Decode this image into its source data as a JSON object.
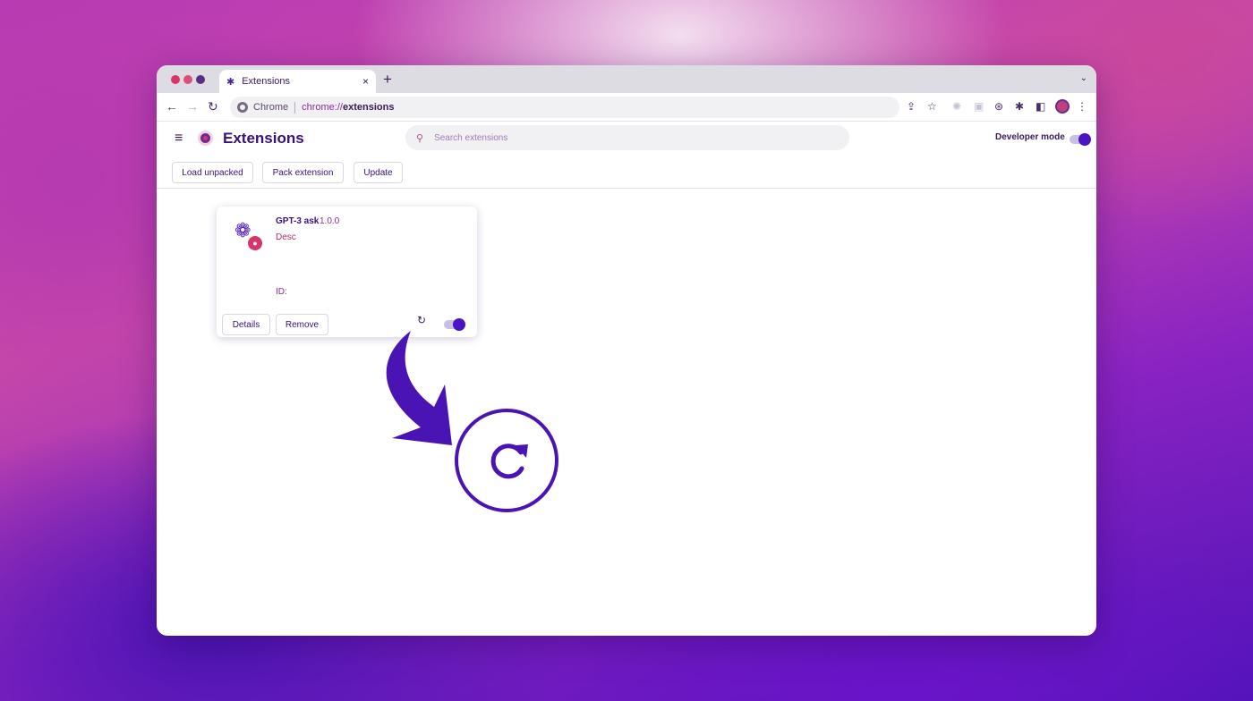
{
  "browser": {
    "tab": {
      "icon": "puzzle-icon",
      "title": "Extensions",
      "close": "×"
    },
    "new_tab": "+",
    "tab_dropdown": "⌄",
    "omnibox": {
      "site_label": "Chrome",
      "url_scheme": "chrome://",
      "url_host": "extensions"
    }
  },
  "page": {
    "title": "Extensions",
    "search_placeholder": "Search extensions",
    "developer_mode_label": "Developer mode",
    "developer_mode_on": true
  },
  "actions": {
    "load_unpacked": "Load unpacked",
    "pack_extension": "Pack extension",
    "update": "Update"
  },
  "extension_card": {
    "name": "GPT-3 ask",
    "version": "1.0.0",
    "description": "Desc",
    "id_label": "ID:",
    "details_label": "Details",
    "remove_label": "Remove",
    "enabled": true
  },
  "colors": {
    "accent": "#4a14b4",
    "title": "#3a1078",
    "pink": "#d8356c"
  }
}
